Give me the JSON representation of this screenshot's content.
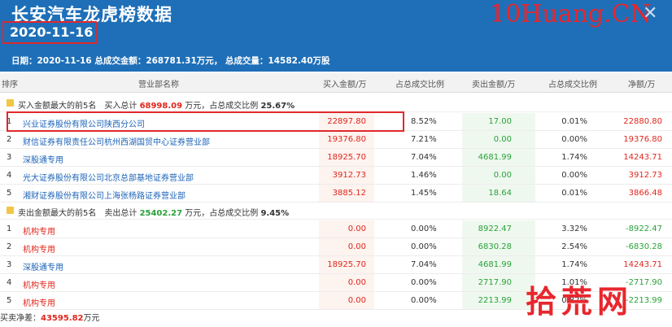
{
  "header": {
    "title": "长安汽车龙虎榜数据",
    "date": "2020-11-16",
    "summary": "日期：2020-11-16 总成交金额：268781.31万元， 总成交量：14582.40万股",
    "watermark": "10Huang.CN",
    "close_glyph": "✕"
  },
  "columns": {
    "rank": "排序",
    "name": "营业部名称",
    "buy": "买入金额/万",
    "buy_pct": "占总成交比例",
    "sell": "卖出金额/万",
    "sell_pct": "占总成交比例",
    "net": "净额/万"
  },
  "buy_group": {
    "label": "买入金额最大的前5名　买入总计",
    "total": "68998.09",
    "unit_text": "万元，占总成交比例",
    "pct": "25.67%"
  },
  "buy_rows": [
    {
      "rank": "1",
      "name": "兴业证券股份有限公司陕西分公司",
      "buy": "22897.80",
      "buy_pct": "8.52%",
      "sell": "17.00",
      "sell_pct": "0.01%",
      "net": "22880.80"
    },
    {
      "rank": "2",
      "name": "财信证券有限责任公司杭州西湖国贸中心证券营业部",
      "buy": "19376.80",
      "buy_pct": "7.21%",
      "sell": "0.00",
      "sell_pct": "0.00%",
      "net": "19376.80"
    },
    {
      "rank": "3",
      "name": "深股通专用",
      "buy": "18925.70",
      "buy_pct": "7.04%",
      "sell": "4681.99",
      "sell_pct": "1.74%",
      "net": "14243.71"
    },
    {
      "rank": "4",
      "name": "光大证券股份有限公司北京总部基地证券营业部",
      "buy": "3912.73",
      "buy_pct": "1.46%",
      "sell": "0.00",
      "sell_pct": "0.00%",
      "net": "3912.73"
    },
    {
      "rank": "5",
      "name": "湘财证券股份有限公司上海张杨路证券营业部",
      "buy": "3885.12",
      "buy_pct": "1.45%",
      "sell": "18.64",
      "sell_pct": "0.01%",
      "net": "3866.48"
    }
  ],
  "sell_group": {
    "label": "卖出金额最大的前5名　卖出总计",
    "total": "25402.27",
    "unit_text": "万元，占总成交比例",
    "pct": "9.45%"
  },
  "sell_rows": [
    {
      "rank": "1",
      "name": "机构专用",
      "buy": "0.00",
      "buy_pct": "0.00%",
      "sell": "8922.47",
      "sell_pct": "3.32%",
      "net": "-8922.47"
    },
    {
      "rank": "2",
      "name": "机构专用",
      "buy": "0.00",
      "buy_pct": "0.00%",
      "sell": "6830.28",
      "sell_pct": "2.54%",
      "net": "-6830.28"
    },
    {
      "rank": "3",
      "name": "深股通专用",
      "buy": "18925.70",
      "buy_pct": "7.04%",
      "sell": "4681.99",
      "sell_pct": "1.74%",
      "net": "14243.71"
    },
    {
      "rank": "4",
      "name": "机构专用",
      "buy": "0.00",
      "buy_pct": "0.00%",
      "sell": "2717.90",
      "sell_pct": "1.01%",
      "net": "-2717.90"
    },
    {
      "rank": "5",
      "name": "机构专用",
      "buy": "0.00",
      "buy_pct": "0.00%",
      "sell": "2213.99",
      "sell_pct": "0.82%",
      "net": "-2213.99"
    }
  ],
  "footer": {
    "label": "买卖净差：",
    "value": "43595.82",
    "unit": "万元"
  },
  "logo": "拾荒网",
  "colors": {
    "header_bg": "#1e6fb8",
    "buy": "#e1261c",
    "sell": "#2aa13a",
    "link": "#1c63b7",
    "highlight": "#e0282d"
  }
}
